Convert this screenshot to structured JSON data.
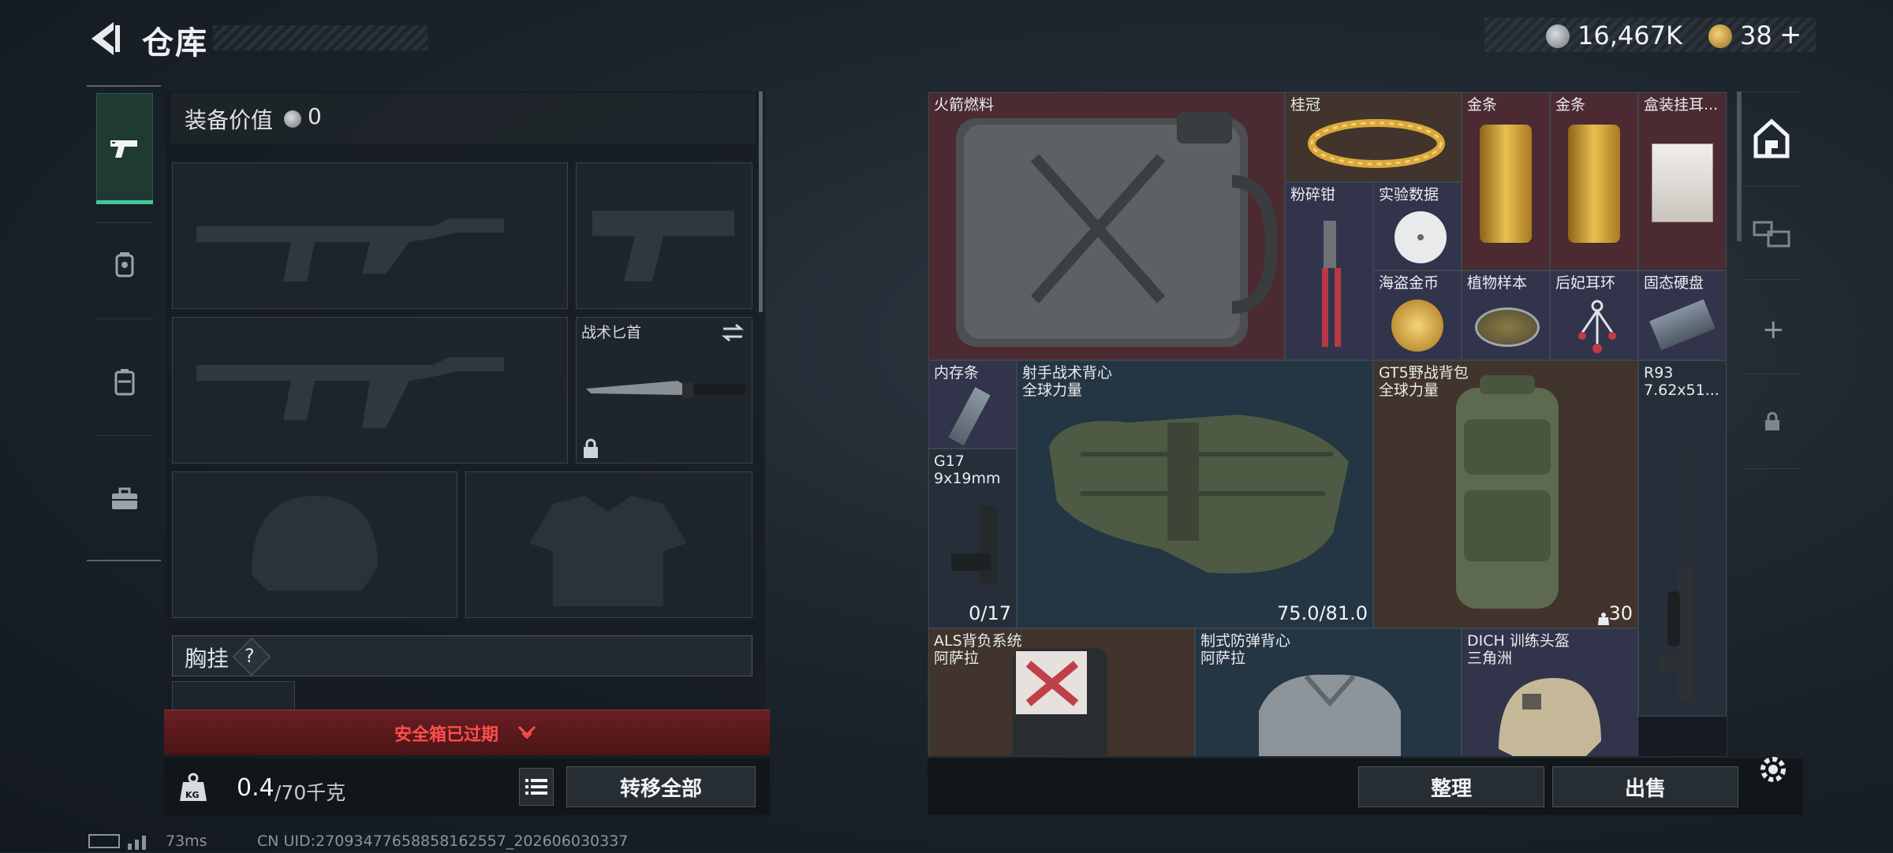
{
  "header": {
    "title": "仓库",
    "currency_silver": "16,467K",
    "currency_gold": "38",
    "plus": "+"
  },
  "equipment": {
    "value_label": "装备价值",
    "value": "0",
    "knife_label": "战术匕首",
    "chest_label": "胸挂",
    "chest_help": "?"
  },
  "safebox": {
    "expired_text": "安全箱已过期"
  },
  "weight": {
    "current": "0.4",
    "capacity": "/70千克",
    "kg_badge": "KG"
  },
  "buttons": {
    "transfer_all": "转移全部",
    "organize": "整理",
    "sell": "出售"
  },
  "items": [
    {
      "label": "火箭燃料"
    },
    {
      "label": "桂冠"
    },
    {
      "label": "金条"
    },
    {
      "label": "金条"
    },
    {
      "label": "盒装挂耳..."
    },
    {
      "label": "粉碎钳"
    },
    {
      "label": "实验数据"
    },
    {
      "label": "海盗金币"
    },
    {
      "label": "植物样本"
    },
    {
      "label": "后妃耳环"
    },
    {
      "label": "固态硬盘"
    },
    {
      "label": "内存条"
    },
    {
      "label": "射手战术背心",
      "sub": "全球力量",
      "count": "75.0/81.0"
    },
    {
      "label": "GT5野战背包",
      "sub": "全球力量",
      "count": "30"
    },
    {
      "label": "R93",
      "sub": "7.62x51..."
    },
    {
      "label": "G17",
      "sub": "9x19mm",
      "count": "0/17"
    },
    {
      "label": "ALS背负系统",
      "sub": "阿萨拉"
    },
    {
      "label": "制式防弹背心",
      "sub": "阿萨拉"
    },
    {
      "label": "DICH 训练头盔",
      "sub": "三角洲"
    }
  ],
  "status": {
    "ping": "73ms",
    "uid": "CN UID:27093477658858162557_202606030337"
  },
  "colors": {
    "accent": "#43c79a",
    "warning": "#ff4f4a",
    "red_cell": "#4b2a31",
    "blue_cell": "#243543"
  }
}
